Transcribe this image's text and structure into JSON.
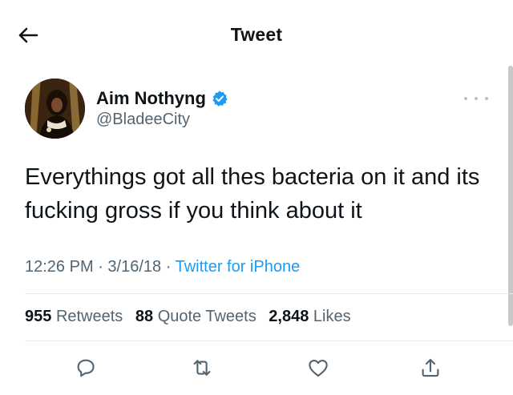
{
  "header": {
    "title": "Tweet",
    "back_icon": "arrow-left-icon"
  },
  "tweet": {
    "author": {
      "name": "Aim Nothyng",
      "handle": "@BladeeCity",
      "verified": true,
      "verified_color": "#1d9bf0"
    },
    "text": "Everythings got all thes bacteria on it and its fucking gross if you think about it",
    "time": "12:26 PM",
    "date": "3/16/18",
    "separator": "·",
    "source": "Twitter for iPhone"
  },
  "stats": {
    "retweets": {
      "count": "955",
      "label": "Retweets"
    },
    "quote_tweets": {
      "count": "88",
      "label": "Quote Tweets"
    },
    "likes": {
      "count": "2,848",
      "label": "Likes"
    }
  },
  "actions": [
    "reply-icon",
    "retweet-icon",
    "like-icon",
    "share-icon"
  ],
  "colors": {
    "accent": "#1d9bf0",
    "text": "#0f1419",
    "muted": "#536471"
  }
}
